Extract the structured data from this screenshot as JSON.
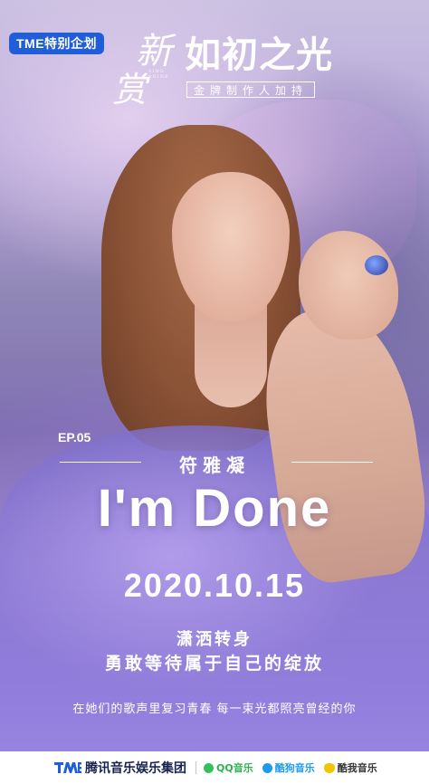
{
  "header": {
    "badge": "TME特别企划",
    "xinshang_char1": "新",
    "xinshang_char2": "赏",
    "xinshang_sub": "SING SHINE",
    "title": "如初之光",
    "subtitle": "金牌制作人加持"
  },
  "episode": {
    "label": "EP.05",
    "artist": "符雅凝",
    "song": "I'm Done",
    "date": "2020.10.15",
    "tagline_1": "潇洒转身",
    "tagline_2": "勇敢等待属于自己的绽放",
    "slogan": "在她们的歌声里复习青春  每一束光都照亮曾经的你"
  },
  "footer": {
    "group": "腾讯音乐娱乐集团",
    "brands": [
      "QQ音乐",
      "酷狗音乐",
      "酷我音乐"
    ]
  },
  "colors": {
    "badge_bg": "#1f5ed8",
    "footer_bg": "#ffffff",
    "qq_green": "#36c05c",
    "kugou_blue": "#1a9bf0",
    "kuwo_yellow": "#f5c400"
  },
  "icons": [
    "tme-logo-icon",
    "qq-music-icon",
    "kugou-music-icon",
    "kuwo-music-icon"
  ]
}
